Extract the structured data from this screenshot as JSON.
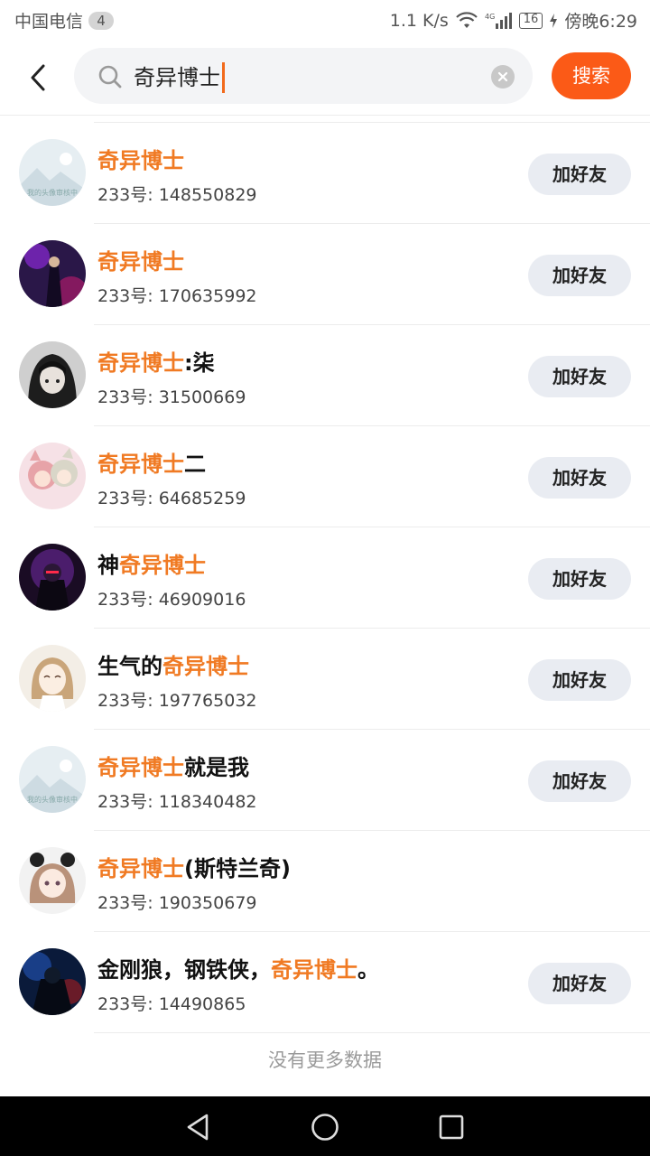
{
  "status_bar": {
    "carrier": "中国电信",
    "notification_count": "4",
    "network_speed": "1.1 K/s",
    "signal_label": "4G",
    "battery": "16",
    "time": "傍晚6:29"
  },
  "search": {
    "query": "奇异博士",
    "button_label": "搜索",
    "accent_color": "#fb5a17",
    "highlight_color": "#f07a23"
  },
  "results": [
    {
      "name_parts": [
        "",
        "奇异博士",
        ""
      ],
      "uid": "233号: 148550829",
      "button": "加好友",
      "avatar": "placeholder"
    },
    {
      "name_parts": [
        "",
        "奇异博士",
        ""
      ],
      "uid": "233号: 170635992",
      "button": "加好友",
      "avatar": "purple"
    },
    {
      "name_parts": [
        "",
        "奇异博士",
        ":柒"
      ],
      "uid": "233号: 31500669",
      "button": "加好友",
      "avatar": "dark-hood"
    },
    {
      "name_parts": [
        "",
        "奇异博士",
        "二"
      ],
      "uid": "233号: 64685259",
      "button": "加好友",
      "avatar": "pink-anime"
    },
    {
      "name_parts": [
        "神",
        "奇异博士",
        ""
      ],
      "uid": "233号: 46909016",
      "button": "加好友",
      "avatar": "dark-red"
    },
    {
      "name_parts": [
        "生气的",
        "奇异博士",
        ""
      ],
      "uid": "233号: 197765032",
      "button": "加好友",
      "avatar": "light-anime"
    },
    {
      "name_parts": [
        "",
        "奇异博士",
        "就是我"
      ],
      "uid": "233号: 118340482",
      "button": "加好友",
      "avatar": "placeholder"
    },
    {
      "name_parts": [
        "",
        "奇异博士",
        "(斯特兰奇)"
      ],
      "uid": "233号: 190350679",
      "button": "",
      "avatar": "panda-girl"
    },
    {
      "name_parts": [
        "金刚狼，钢铁侠，",
        "奇异博士",
        "。"
      ],
      "uid": "233号: 14490865",
      "button": "加好友",
      "avatar": "blue-dark"
    }
  ],
  "footer": {
    "no_more_text": "没有更多数据"
  },
  "avatar_placeholder_text": "我的头像审核中"
}
